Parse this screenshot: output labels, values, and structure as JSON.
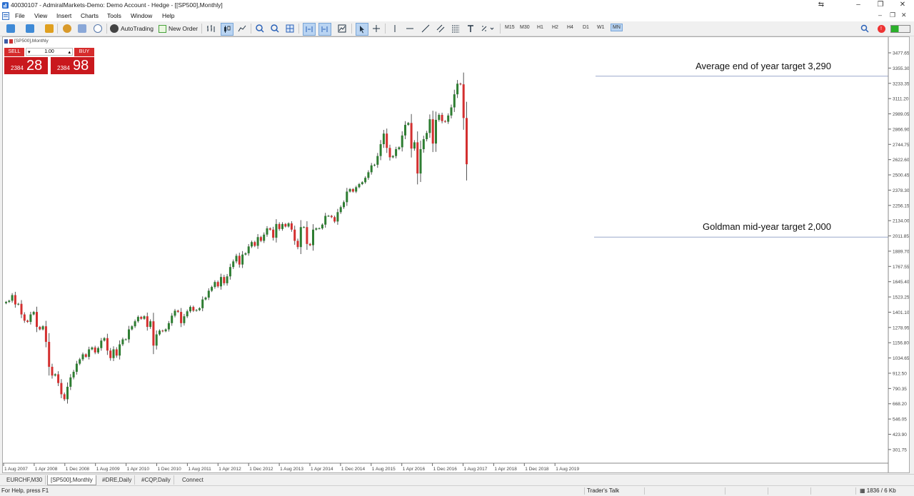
{
  "window": {
    "title": "40030107 - AdmiralMarkets-Demo: Demo Account - Hedge - [[SP500],Monthly]"
  },
  "menu": [
    "File",
    "View",
    "Insert",
    "Charts",
    "Tools",
    "Window",
    "Help"
  ],
  "toolbar": {
    "autotrading": "AutoTrading",
    "new_order": "New Order",
    "timeframes": [
      "M15",
      "M30",
      "H1",
      "H2",
      "H4",
      "D1",
      "W1",
      "MN"
    ],
    "active_timeframe": "MN"
  },
  "chart": {
    "label": "[SP500],Monthly",
    "trade_panel": {
      "sell_label": "SELL",
      "buy_label": "BUY",
      "lot": "1.00",
      "sell_small": "2384",
      "sell_big": "28",
      "buy_small": "2384",
      "buy_big": "98"
    },
    "annotations": [
      {
        "text": "Average end of year target 3,290",
        "price": 3290
      },
      {
        "text": "Goldman mid-year target 2,000",
        "price": 2000
      }
    ],
    "price_ticks": [
      "3477.65",
      "3355.30",
      "3233.35",
      "3111.20",
      "2989.05",
      "2866.90",
      "2744.75",
      "2622.60",
      "2500.45",
      "2378.30",
      "2256.15",
      "2134.00",
      "2011.85",
      "1889.70",
      "1767.55",
      "1645.40",
      "1523.25",
      "1401.10",
      "1278.95",
      "1156.80",
      "1034.65",
      "912.50",
      "790.35",
      "668.20",
      "546.05",
      "423.90",
      "301.75"
    ],
    "time_ticks": [
      "1 Aug 2007",
      "1 Apr 2008",
      "1 Dec 2008",
      "1 Aug 2009",
      "1 Apr 2010",
      "1 Dec 2010",
      "1 Aug 2011",
      "1 Apr 2012",
      "1 Dec 2012",
      "1 Aug 2013",
      "1 Apr 2014",
      "1 Dec 2014",
      "1 Aug 2015",
      "1 Apr 2016",
      "1 Dec 2016",
      "1 Aug 2017",
      "1 Apr 2018",
      "1 Dec 2018",
      "1 Aug 2019"
    ]
  },
  "chart_data": {
    "type": "candlestick",
    "symbol": "[SP500]",
    "timeframe": "Monthly",
    "x_start": "2007-07",
    "ylim": [
      301.75,
      3477.65
    ],
    "closes": [
      1480,
      1490,
      1535,
      1460,
      1465,
      1380,
      1330,
      1320,
      1380,
      1400,
      1280,
      1260,
      1285,
      1160,
      960,
      890,
      900,
      830,
      740,
      700,
      800,
      875,
      920,
      985,
      1020,
      1060,
      1040,
      1100,
      1115,
      1075,
      1110,
      1170,
      1190,
      1090,
      1030,
      1100,
      1050,
      1140,
      1180,
      1180,
      1260,
      1285,
      1325,
      1360,
      1345,
      1365,
      1280,
      1325,
      1130,
      1220,
      1250,
      1245,
      1260,
      1310,
      1370,
      1410,
      1400,
      1310,
      1365,
      1405,
      1440,
      1410,
      1415,
      1430,
      1500,
      1515,
      1570,
      1600,
      1640,
      1605,
      1680,
      1630,
      1685,
      1760,
      1805,
      1850,
      1780,
      1860,
      1870,
      1925,
      1960,
      1930,
      2000,
      1970,
      2020,
      2070,
      2060,
      1995,
      2105,
      2065,
      2105,
      2085,
      2110,
      2060,
      1970,
      1920,
      2080,
      2080,
      1945,
      1935,
      2060,
      2070,
      2070,
      2100,
      2170,
      2170,
      2160,
      2125,
      2200,
      2240,
      2280,
      2365,
      2385,
      2365,
      2400,
      2425,
      2440,
      2475,
      2520,
      2575,
      2580,
      2650,
      2745,
      2830,
      2715,
      2640,
      2650,
      2705,
      2720,
      2815,
      2900,
      2915,
      2710,
      2760,
      2510,
      2705,
      2785,
      2835,
      2945,
      2750,
      2940,
      2980,
      2930,
      2925,
      2975,
      3040,
      3145,
      3230,
      3225,
      2955,
      2584
    ]
  }
}
